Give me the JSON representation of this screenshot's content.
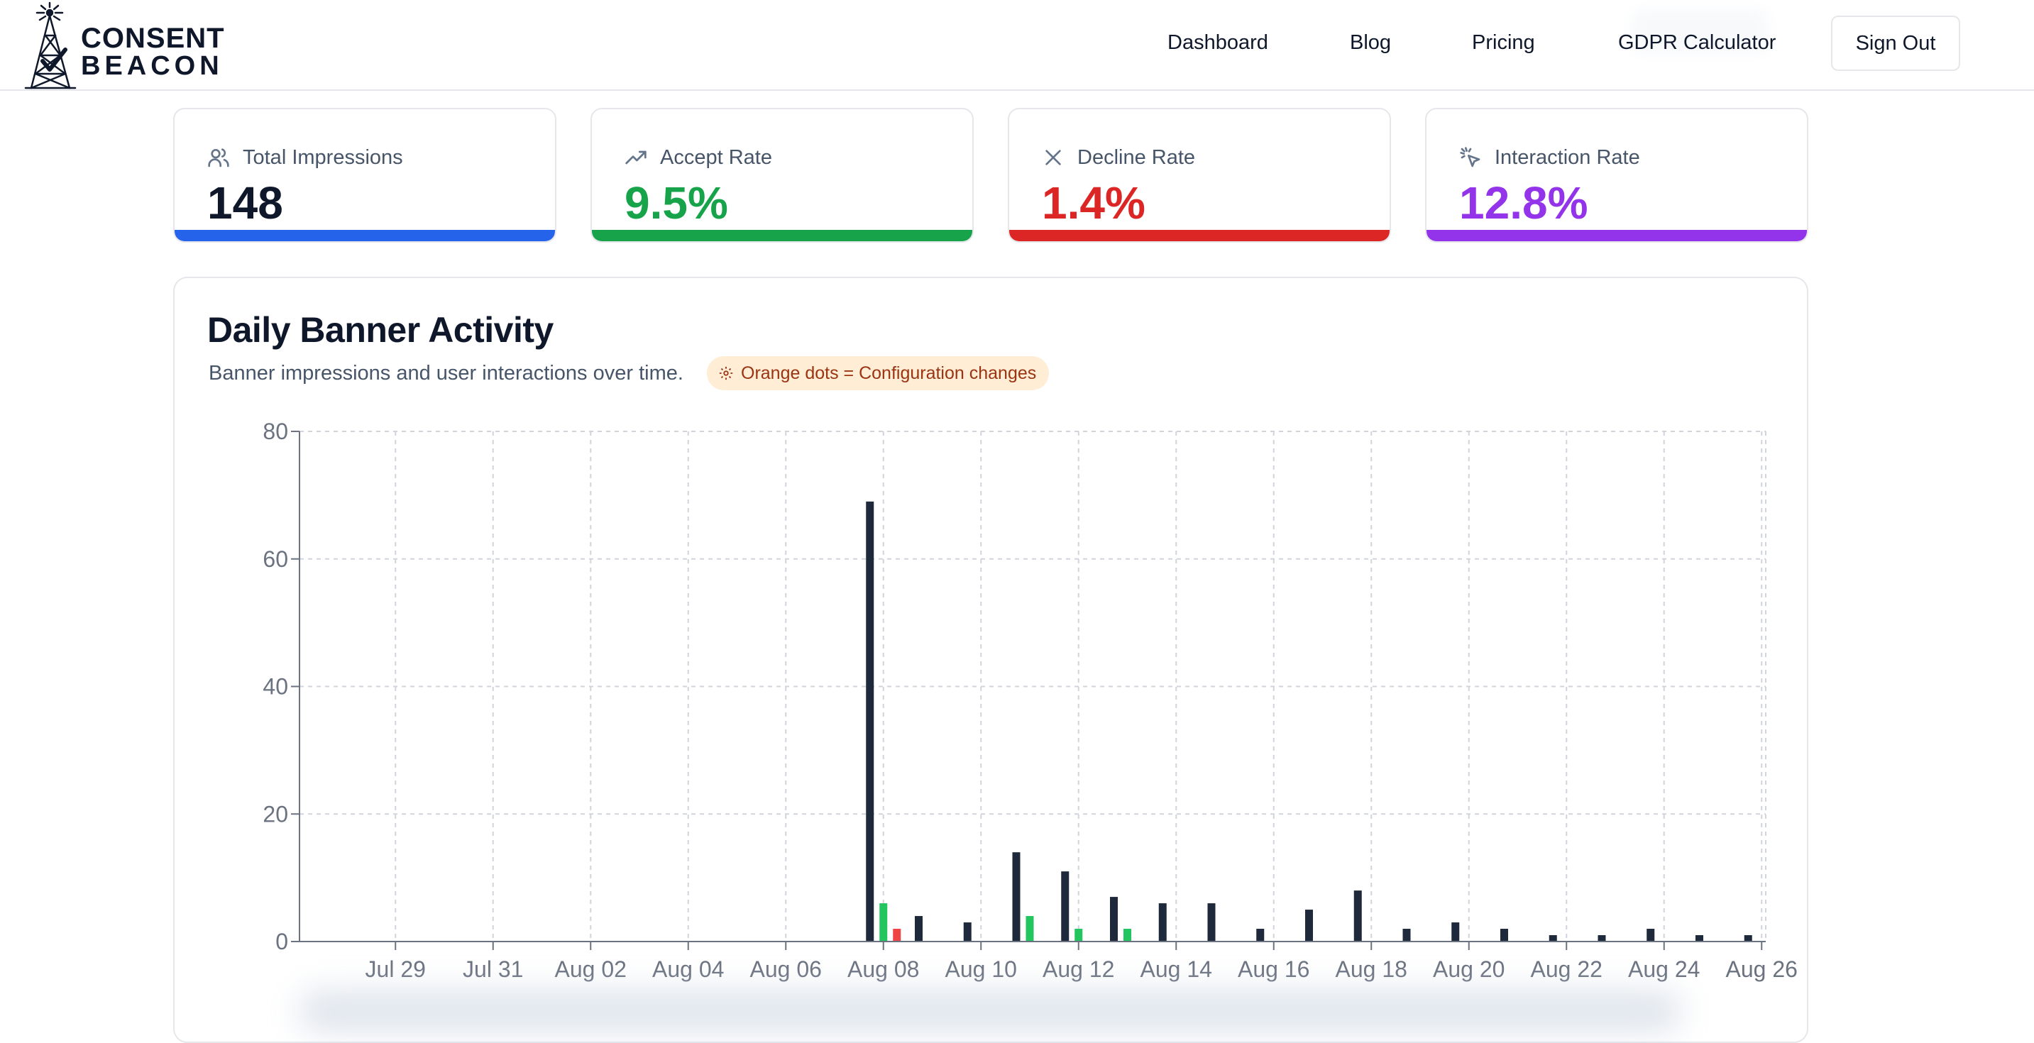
{
  "header": {
    "logo": {
      "line1": "CONSENT",
      "line2": "BEACON"
    },
    "nav": [
      {
        "label": "Dashboard",
        "key": "dashboard"
      },
      {
        "label": "Blog",
        "key": "blog"
      },
      {
        "label": "Pricing",
        "key": "pricing"
      },
      {
        "label": "GDPR Calculator",
        "key": "gdpr-calculator"
      }
    ],
    "sign_out": "Sign Out"
  },
  "stats": [
    {
      "label": "Total Impressions",
      "value": "148",
      "color": "#2563eb",
      "value_color": "#0f172a",
      "icon": "users-icon"
    },
    {
      "label": "Accept Rate",
      "value": "9.5%",
      "color": "#16a34a",
      "value_color": "#16a34a",
      "icon": "trending-up-icon"
    },
    {
      "label": "Decline Rate",
      "value": "1.4%",
      "color": "#dc2626",
      "value_color": "#dc2626",
      "icon": "x-icon"
    },
    {
      "label": "Interaction Rate",
      "value": "12.8%",
      "color": "#9333ea",
      "value_color": "#9333ea",
      "icon": "pointer-click-icon"
    }
  ],
  "chart_panel": {
    "title": "Daily Banner Activity",
    "subtitle": "Banner impressions and user interactions over time.",
    "badge": "Orange dots = Configuration changes",
    "badge_icon": "gear-icon"
  },
  "chart_data": {
    "type": "bar",
    "ylim": [
      0,
      80
    ],
    "yticks": [
      0,
      20,
      40,
      60,
      80
    ],
    "grid": true,
    "x_start": "Jul 28",
    "x_end": "Aug 26",
    "tick_labels": [
      "Jul 29",
      "Jul 31",
      "Aug 02",
      "Aug 04",
      "Aug 06",
      "Aug 08",
      "Aug 10",
      "Aug 12",
      "Aug 14",
      "Aug 16",
      "Aug 18",
      "Aug 20",
      "Aug 22",
      "Aug 24",
      "Aug 26"
    ],
    "dates": [
      "Aug 08",
      "Aug 09",
      "Aug 10",
      "Aug 11",
      "Aug 12",
      "Aug 13",
      "Aug 14",
      "Aug 15",
      "Aug 16",
      "Aug 17",
      "Aug 18",
      "Aug 19",
      "Aug 20",
      "Aug 21",
      "Aug 22",
      "Aug 23",
      "Aug 24",
      "Aug 25",
      "Aug 26"
    ],
    "series": [
      {
        "key": "impressions",
        "color": "#1e293b",
        "values": [
          69,
          4,
          3,
          14,
          11,
          7,
          6,
          6,
          2,
          5,
          8,
          2,
          3,
          2,
          1,
          1,
          2,
          1,
          1
        ]
      },
      {
        "key": "accepts",
        "color": "#22c55e",
        "values": [
          6,
          0,
          0,
          4,
          2,
          2,
          0,
          0,
          0,
          0,
          0,
          0,
          0,
          0,
          0,
          0,
          0,
          0,
          0
        ]
      },
      {
        "key": "declines",
        "color": "#ef4444",
        "values": [
          2,
          0,
          0,
          0,
          0,
          0,
          0,
          0,
          0,
          0,
          0,
          0,
          0,
          0,
          0,
          0,
          0,
          0,
          0
        ]
      }
    ]
  }
}
